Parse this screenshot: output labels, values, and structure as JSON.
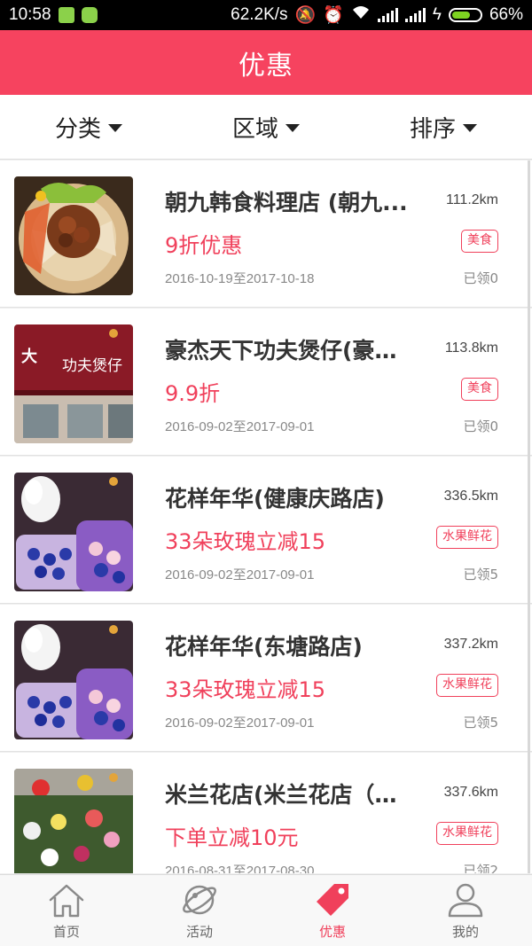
{
  "status_bar": {
    "time": "10:58",
    "network_speed": "62.2K/s",
    "battery": "66%",
    "battery_level": 0.66
  },
  "header": {
    "title": "优惠"
  },
  "filters": [
    {
      "label": "分类"
    },
    {
      "label": "区域"
    },
    {
      "label": "排序"
    }
  ],
  "deals": [
    {
      "name": "朝九韩食料理店 (朝九...",
      "distance": "111.2km",
      "promo": "9折优惠",
      "category": "美食",
      "date_range": "2016-10-19至2017-10-18",
      "claimed": "已领0",
      "image": "korean-bbq-platter"
    },
    {
      "name": "豪杰天下功夫煲仔(豪杰...",
      "distance": "113.8km",
      "promo": "9.9折",
      "category": "美食",
      "date_range": "2016-09-02至2017-09-01",
      "claimed": "已领0",
      "image": "restaurant-storefront"
    },
    {
      "name": "花样年华(健康庆路店)",
      "distance": "336.5km",
      "promo": "33朵玫瑰立减15",
      "category": "水果鲜花",
      "date_range": "2016-09-02至2017-09-01",
      "claimed": "已领5",
      "image": "flower-bouquet"
    },
    {
      "name": "花样年华(东塘路店)",
      "distance": "337.2km",
      "promo": "33朵玫瑰立减15",
      "category": "水果鲜花",
      "date_range": "2016-09-02至2017-09-01",
      "claimed": "已领5",
      "image": "flower-bouquet"
    },
    {
      "name": "米兰花店(米兰花店（向...",
      "distance": "337.6km",
      "promo": "下单立减10元",
      "category": "水果鲜花",
      "date_range": "2016-08-31至2017-08-30",
      "claimed": "已领2",
      "image": "flower-shop"
    }
  ],
  "store_sign_text": "功夫煲仔",
  "tabs": [
    {
      "label": "首页",
      "icon": "home-icon",
      "active": false
    },
    {
      "label": "活动",
      "icon": "planet-icon",
      "active": false
    },
    {
      "label": "优惠",
      "icon": "tag-icon",
      "active": true
    },
    {
      "label": "我的",
      "icon": "user-icon",
      "active": false
    }
  ],
  "colors": {
    "accent": "#f6435f",
    "promo_text": "#f0405b",
    "tab_inactive": "#666666"
  }
}
